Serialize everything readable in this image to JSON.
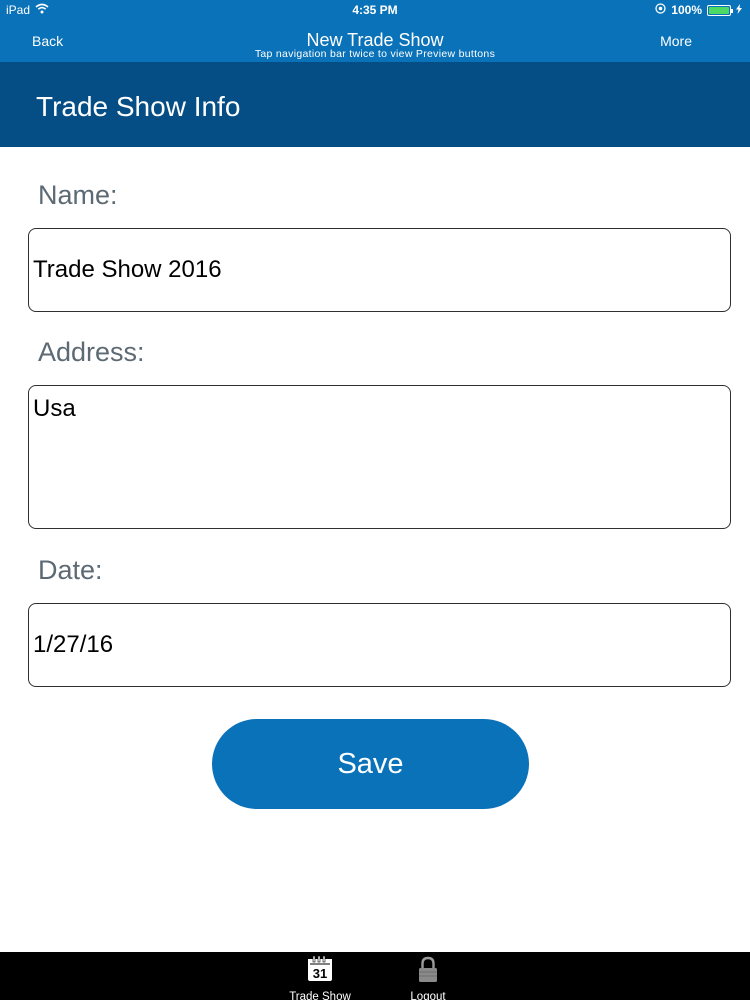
{
  "status_bar": {
    "device": "iPad",
    "time": "4:35 PM",
    "battery": "100%",
    "battery_level": 1.0,
    "battery_color": "#4cd964"
  },
  "nav": {
    "back_label": "Back",
    "title": "New Trade Show",
    "subtitle": "Tap navigation bar twice to view Preview buttons",
    "more_label": "More"
  },
  "section": {
    "title": "Trade Show Info"
  },
  "form": {
    "name_label": "Name:",
    "name_value": "Trade Show 2016",
    "address_label": "Address:",
    "address_value": "Usa",
    "date_label": "Date:",
    "date_value": "1/27/16",
    "save_label": "Save"
  },
  "tabs": [
    {
      "label": "Trade Show",
      "icon": "calendar-icon",
      "icon_text": "31"
    },
    {
      "label": "Logout",
      "icon": "lock-icon"
    }
  ],
  "colors": {
    "nav_bar": "#0a72b8",
    "section_header": "#044d85",
    "button": "#0a72b8",
    "tab_bar": "#000000"
  }
}
